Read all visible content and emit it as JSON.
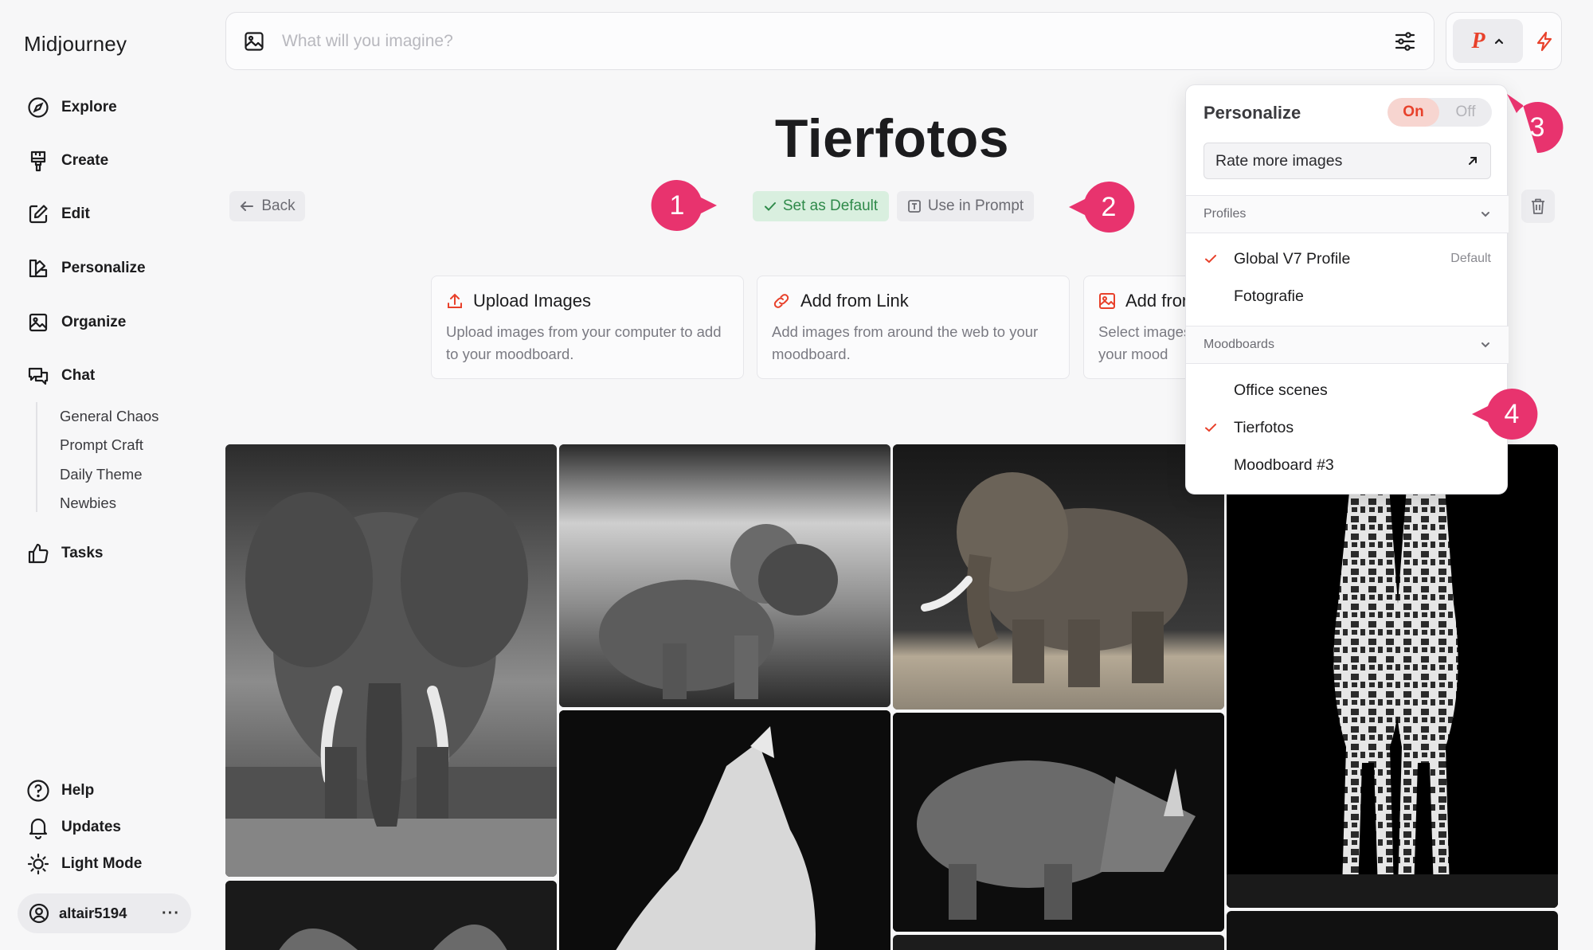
{
  "app": {
    "name": "Midjourney"
  },
  "sidebar": {
    "items": [
      {
        "label": "Explore",
        "icon": "compass-icon"
      },
      {
        "label": "Create",
        "icon": "brush-icon"
      },
      {
        "label": "Edit",
        "icon": "edit-icon"
      },
      {
        "label": "Personalize",
        "icon": "palette-icon"
      },
      {
        "label": "Organize",
        "icon": "image-folder-icon"
      },
      {
        "label": "Chat",
        "icon": "chat-icon"
      }
    ],
    "chat_channels": [
      "General Chaos",
      "Prompt Craft",
      "Daily Theme",
      "Newbies"
    ],
    "tasks": {
      "label": "Tasks",
      "icon": "thumbs-up-icon"
    },
    "bottom": [
      {
        "label": "Help",
        "icon": "help-icon"
      },
      {
        "label": "Updates",
        "icon": "bell-icon"
      },
      {
        "label": "Light Mode",
        "icon": "sun-icon"
      }
    ],
    "user": {
      "name": "altair5194",
      "more": "···"
    }
  },
  "prompt_bar": {
    "placeholder": "What will you imagine?"
  },
  "top_right": {
    "personalize_letter": "P"
  },
  "page": {
    "title": "Tierfotos",
    "back_label": "Back",
    "set_default_label": "Set as Default",
    "use_in_prompt_label": "Use in Prompt"
  },
  "cards": [
    {
      "title": "Upload Images",
      "desc": "Upload images from your computer to add to your moodboard.",
      "icon": "upload-icon"
    },
    {
      "title": "Add from Link",
      "desc": "Add images from around the web to your moodboard.",
      "icon": "link-icon"
    },
    {
      "title": "Add from",
      "desc": "Select images to your mood",
      "icon": "gallery-icon"
    }
  ],
  "dropdown": {
    "title": "Personalize",
    "toggle_on": "On",
    "toggle_off": "Off",
    "rate_label": "Rate more images",
    "profiles_header": "Profiles",
    "profiles": [
      {
        "name": "Global V7 Profile",
        "tag": "Default",
        "checked": true
      },
      {
        "name": "Fotografie",
        "tag": "",
        "checked": false
      }
    ],
    "moodboards_header": "Moodboards",
    "moodboards": [
      {
        "name": "Office scenes",
        "checked": false
      },
      {
        "name": "Tierfotos",
        "checked": true
      },
      {
        "name": "Moodboard #3",
        "checked": false
      }
    ]
  },
  "annotations": [
    "1",
    "2",
    "3",
    "4"
  ],
  "colors": {
    "accent": "#e8412b",
    "marker": "#e8336e",
    "success": "#2f8a4a"
  }
}
